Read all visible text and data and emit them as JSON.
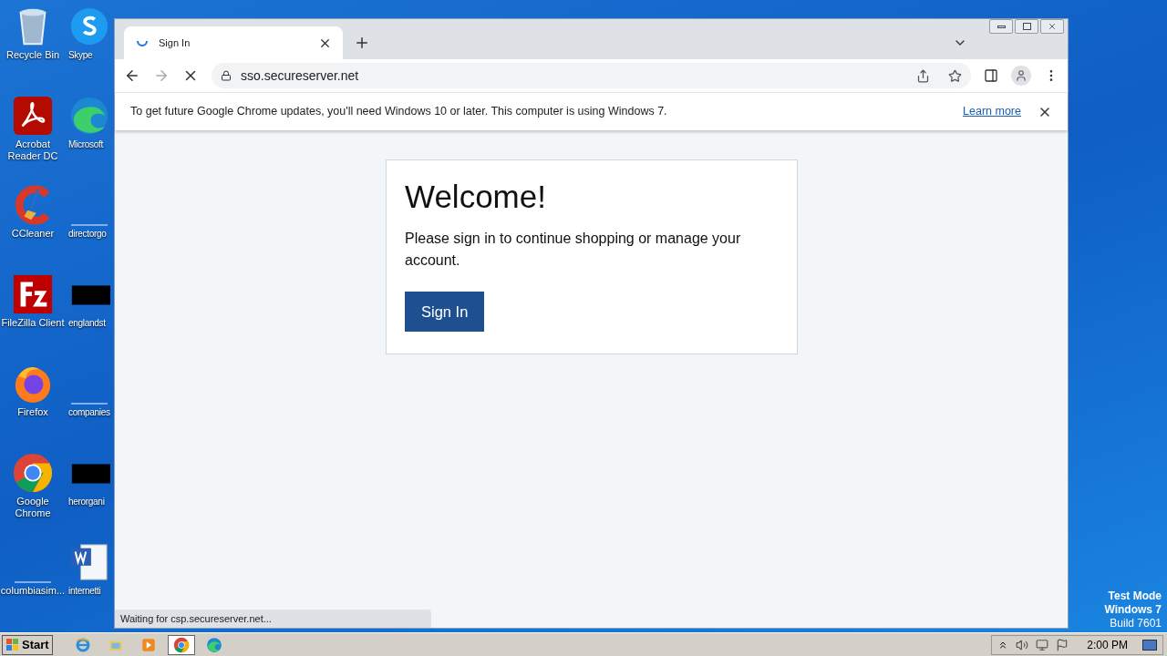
{
  "desktop": {
    "icons": [
      {
        "label": "Recycle Bin",
        "kind": "recycle"
      },
      {
        "label": "Skype",
        "kind": "skype"
      },
      {
        "label": "Acrobat Reader DC",
        "kind": "acrobat"
      },
      {
        "label": "Microsoft",
        "kind": "edge"
      },
      {
        "label": "CCleaner",
        "kind": "ccleaner"
      },
      {
        "label": "directorgo",
        "kind": "blank"
      },
      {
        "label": "FileZilla Client",
        "kind": "filezilla"
      },
      {
        "label": "englandst",
        "kind": "black"
      },
      {
        "label": "Firefox",
        "kind": "firefox"
      },
      {
        "label": "companies",
        "kind": "blank"
      },
      {
        "label": "Google Chrome",
        "kind": "chrome"
      },
      {
        "label": "herorgani",
        "kind": "black"
      },
      {
        "label": "columbiasim...",
        "kind": "blank"
      },
      {
        "label": "internetti",
        "kind": "word"
      }
    ],
    "test_mode": [
      "Test Mode",
      "Windows 7",
      "Build 7601"
    ]
  },
  "browser": {
    "tab": {
      "title": "Sign In",
      "loading": true
    },
    "address": "sso.secureserver.net",
    "infobar": {
      "text": "To get future Google Chrome updates, you'll need Windows 10 or later. This computer is using Windows 7.",
      "link": "Learn more"
    },
    "page": {
      "heading": "Welcome!",
      "text": "Please sign in to continue shopping or manage your account.",
      "button": "Sign In"
    },
    "status": "Waiting for csp.secureserver.net..."
  },
  "taskbar": {
    "start": "Start",
    "apps": [
      {
        "kind": "ie",
        "selected": false
      },
      {
        "kind": "explorer",
        "selected": false
      },
      {
        "kind": "media",
        "selected": false
      },
      {
        "kind": "chrome",
        "selected": true
      },
      {
        "kind": "edge",
        "selected": false
      }
    ],
    "clock": "2:00 PM"
  }
}
